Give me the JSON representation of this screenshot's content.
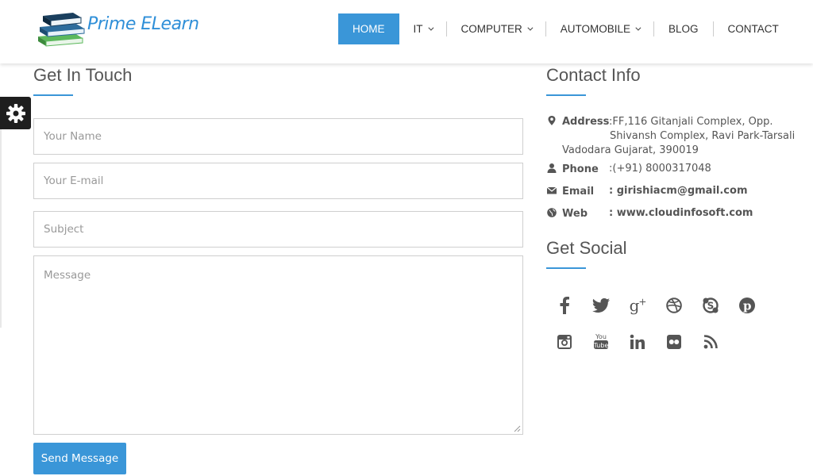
{
  "brand": {
    "logo_text": "Prime ELearn"
  },
  "nav": {
    "items": [
      {
        "label": "HOME",
        "active": true,
        "dropdown": false
      },
      {
        "label": "IT",
        "active": false,
        "dropdown": true
      },
      {
        "label": "COMPUTER",
        "active": false,
        "dropdown": true
      },
      {
        "label": "AUTOMOBILE",
        "active": false,
        "dropdown": true
      },
      {
        "label": "BLOG",
        "active": false,
        "dropdown": false
      },
      {
        "label": "CONTACT",
        "active": false,
        "dropdown": false
      }
    ]
  },
  "form": {
    "title": "Get In Touch",
    "name_placeholder": "Your Name",
    "email_placeholder": "Your E-mail",
    "subject_placeholder": "Subject",
    "message_placeholder": "Message",
    "submit_label": "Send Message"
  },
  "contact_info": {
    "title": "Contact Info",
    "address_label": "Address",
    "address_line1": ":FF,116 Gitanjali Complex, Opp.",
    "address_line2": "Shivansh Complex, Ravi Park-Tarsali",
    "address_line3": "Vadodara Gujarat, 390019",
    "phone_label": "Phone",
    "phone_value": ":(+91) 8000317048",
    "email_label": "Email",
    "email_value": ": girishiacm@gmail.com",
    "web_label": "Web",
    "web_value": ": www.cloudinfosoft.com"
  },
  "social": {
    "title": "Get Social",
    "icons": [
      "facebook-icon",
      "twitter-icon",
      "google-plus-icon",
      "dribbble-icon",
      "skype-icon",
      "pinterest-icon",
      "instagram-icon",
      "youtube-icon",
      "linkedin-icon",
      "flickr-icon",
      "rss-icon"
    ]
  },
  "colors": {
    "accent": "#3a96d8",
    "text": "#555555",
    "settings_tab": "#1e1e1e"
  }
}
